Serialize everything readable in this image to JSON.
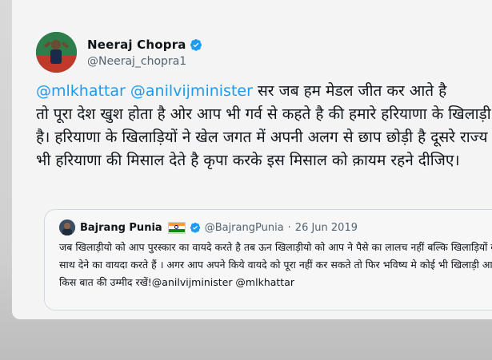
{
  "tweet": {
    "author": {
      "display_name": "Neeraj Chopra",
      "handle": "@Neeraj_chopra1",
      "avatar_icon": "athlete-avatar-icon",
      "verified_icon": "verified-badge-icon"
    },
    "mentions": [
      "@mlkhattar",
      "@anilvijminister"
    ],
    "text_line_1": " सर जब हम मेडल जीत कर आते है",
    "text_rest": "तो पूरा देश खुश होता है ओर आप भी गर्व से कहते है की हमारे हरियाणा के खिलाड़ी है। हरियाणा के खिलाड़ियों ने खेल जगत में अपनी अलग से छाप छोड़ी है दूसरे राज्य भी हरियाणा की मिसाल देते है कृपा करके इस मिसाल को क़ायम रहने दीजिए।"
  },
  "quote": {
    "author": {
      "display_name": "Bajrang Punia",
      "handle": "@BajrangPunia",
      "flag_icon": "india-flag-icon",
      "verified_icon": "verified-badge-icon"
    },
    "separator": "·",
    "date": "26 Jun 2019",
    "text": "जब खिलाड़ीयो को आप पुरस्कार का वायदे करते है तब ऊन खिलाड़ीयो को आप ने पैसे का लालच नहीं बल्कि खिलाड़ियों का साथ देने का वायदा करते हैं । अगर आप अपने किये वायदे को पूरा नहीं कर सकते तो फिर भविष्य मे कोई भी खिलाड़ी आप से किस बात की उम्मीद रखें!@anilvijminister @mlkhattar"
  },
  "colors": {
    "mention": "#1d9bf0",
    "verified": "#1d9bf0",
    "text": "#0f1419",
    "muted": "#536471"
  }
}
